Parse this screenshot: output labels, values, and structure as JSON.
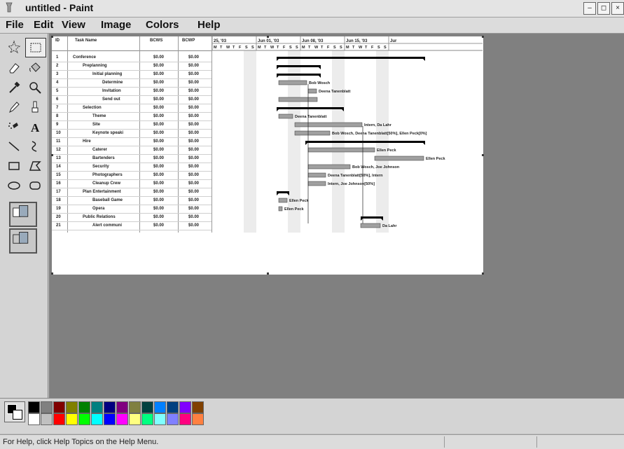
{
  "window": {
    "title": "untitled - Paint",
    "controls": [
      "–",
      "◻",
      "×"
    ]
  },
  "menu": [
    "File",
    "Edit",
    "View",
    "Image",
    "Colors",
    "Help"
  ],
  "tools": [
    "free-form-select-icon",
    "select-icon",
    "eraser-icon",
    "fill-icon",
    "pick-color-icon",
    "magnifier-icon",
    "pencil-icon",
    "brush-icon",
    "airbrush-icon",
    "text-icon",
    "line-icon",
    "curve-icon",
    "rectangle-icon",
    "polygon-icon",
    "ellipse-icon",
    "rounded-rectangle-icon"
  ],
  "gantt": {
    "headers": {
      "id": "ID",
      "task": "Task Name",
      "bcws": "BCWS",
      "bcwp": "BCWP"
    },
    "timeline": [
      {
        "label": "25, '03",
        "days": [
          "M",
          "T",
          "W",
          "T",
          "F",
          "S",
          "S"
        ]
      },
      {
        "label": "Jun 01, '03",
        "days": [
          "M",
          "T",
          "W",
          "T",
          "F",
          "S",
          "S"
        ]
      },
      {
        "label": "Jun 08, '03",
        "days": [
          "M",
          "T",
          "W",
          "T",
          "F",
          "S",
          "S"
        ]
      },
      {
        "label": "Jun 15, '03",
        "days": [
          "M",
          "T",
          "W",
          "T",
          "F",
          "S",
          "S"
        ]
      },
      {
        "label": "Jur",
        "days": []
      }
    ],
    "rows": [
      {
        "id": "1",
        "name": "Conference",
        "bcws": "$0.00",
        "bcwp": "$0.00",
        "indent": 0
      },
      {
        "id": "2",
        "name": "Preplanning",
        "bcws": "$0.00",
        "bcwp": "$0.00",
        "indent": 1
      },
      {
        "id": "3",
        "name": "Initial planning",
        "bcws": "$0.00",
        "bcwp": "$0.00",
        "indent": 2
      },
      {
        "id": "4",
        "name": "Determine",
        "bcws": "$0.00",
        "bcwp": "$0.00",
        "indent": 3
      },
      {
        "id": "5",
        "name": "Invitation",
        "bcws": "$0.00",
        "bcwp": "$0.00",
        "indent": 3
      },
      {
        "id": "6",
        "name": "Send out",
        "bcws": "$0.00",
        "bcwp": "$0.00",
        "indent": 3
      },
      {
        "id": "7",
        "name": "Selection",
        "bcws": "$0.00",
        "bcwp": "$0.00",
        "indent": 1
      },
      {
        "id": "8",
        "name": "Theme",
        "bcws": "$0.00",
        "bcwp": "$0.00",
        "indent": 2
      },
      {
        "id": "9",
        "name": "Site",
        "bcws": "$0.00",
        "bcwp": "$0.00",
        "indent": 2
      },
      {
        "id": "10",
        "name": "Keynote speaki",
        "bcws": "$0.00",
        "bcwp": "$0.00",
        "indent": 2
      },
      {
        "id": "11",
        "name": "Hire",
        "bcws": "$0.00",
        "bcwp": "$0.00",
        "indent": 1
      },
      {
        "id": "12",
        "name": "Caterer",
        "bcws": "$0.00",
        "bcwp": "$0.00",
        "indent": 2
      },
      {
        "id": "13",
        "name": "Bartenders",
        "bcws": "$0.00",
        "bcwp": "$0.00",
        "indent": 2
      },
      {
        "id": "14",
        "name": "Security",
        "bcws": "$0.00",
        "bcwp": "$0.00",
        "indent": 2
      },
      {
        "id": "15",
        "name": "Photographers",
        "bcws": "$0.00",
        "bcwp": "$0.00",
        "indent": 2
      },
      {
        "id": "16",
        "name": "Cleanup Crew",
        "bcws": "$0.00",
        "bcwp": "$0.00",
        "indent": 2
      },
      {
        "id": "17",
        "name": "Plan Entertainment",
        "bcws": "$0.00",
        "bcwp": "$0.00",
        "indent": 1
      },
      {
        "id": "18",
        "name": "Baseball Game",
        "bcws": "$0.00",
        "bcwp": "$0.00",
        "indent": 2
      },
      {
        "id": "19",
        "name": "Opera",
        "bcws": "$0.00",
        "bcwp": "$0.00",
        "indent": 2
      },
      {
        "id": "20",
        "name": "Public Relations",
        "bcws": "$0.00",
        "bcwp": "$0.00",
        "indent": 1
      },
      {
        "id": "21",
        "name": "Alert communi",
        "bcws": "$0.00",
        "bcwp": "$0.00",
        "indent": 2
      }
    ],
    "bar_labels": [
      "Bob Wosch",
      "Deena Tanenblatt",
      "Deena Tanenblatt",
      "Intern, Da Lahr",
      "Bob Wosch, Deena Tanenblatt[50%], Ellen Peck[0%]",
      "Ellen Peck",
      "Ellen Peck",
      "Bob Wosch, Joe Johnson",
      "Deena Tanenblatt[50%], Intern",
      "Intern, Joe Johnson[50%]",
      "Ellen Peck",
      "Ellen Peck",
      "Da Lahr"
    ]
  },
  "palette": {
    "top": [
      "#000000",
      "#808080",
      "#800000",
      "#808000",
      "#008000",
      "#008080",
      "#000080",
      "#800080",
      "#808040",
      "#004040",
      "#0080ff",
      "#004080",
      "#8000ff",
      "#804000"
    ],
    "bottom": [
      "#ffffff",
      "#c0c0c0",
      "#ff0000",
      "#ffff00",
      "#00ff00",
      "#00ffff",
      "#0000ff",
      "#ff00ff",
      "#ffff80",
      "#00ff80",
      "#80ffff",
      "#8080ff",
      "#ff0080",
      "#ff8040"
    ]
  },
  "status": {
    "help_text": "For Help, click Help Topics on the Help Menu."
  }
}
